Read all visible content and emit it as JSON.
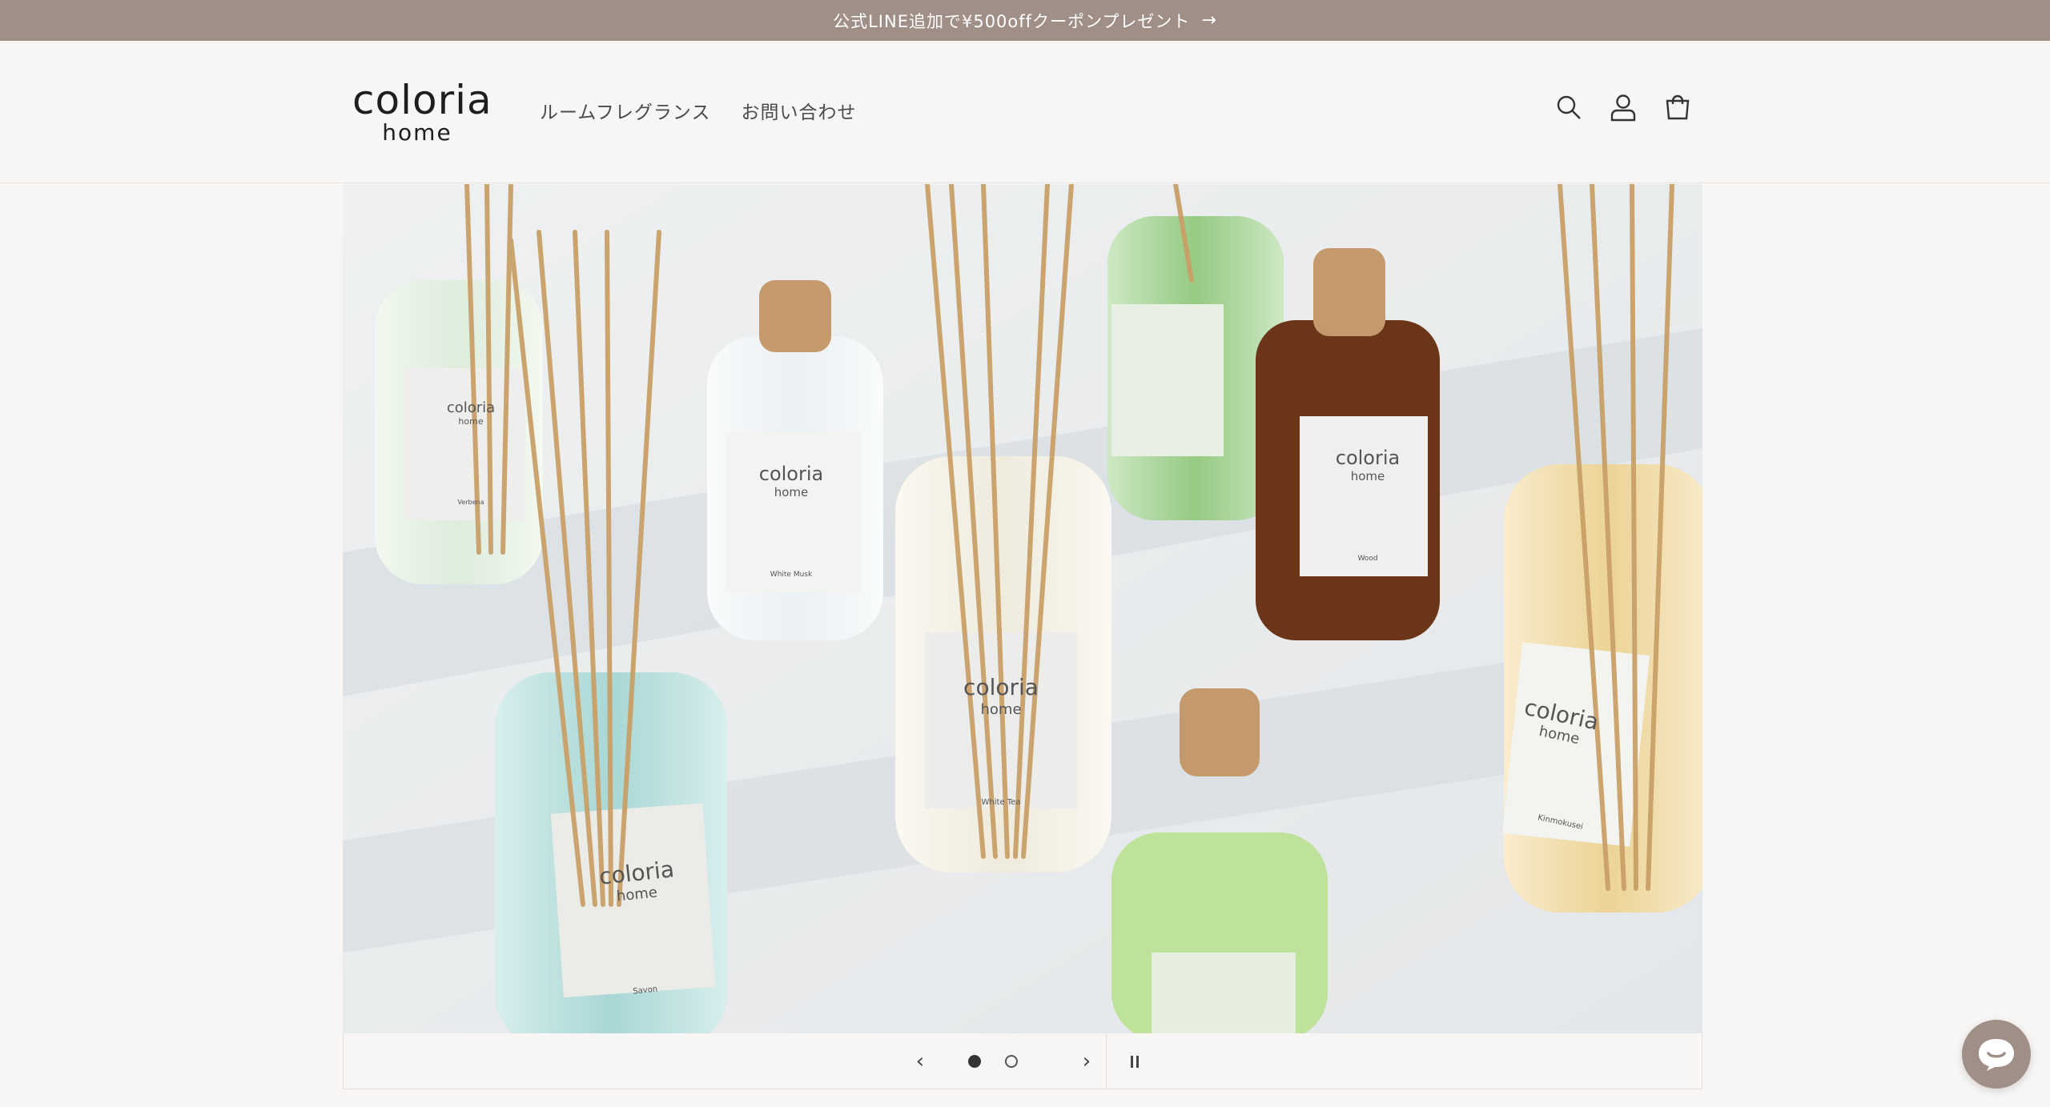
{
  "announcement": {
    "text": "公式LINE追加で¥500offクーポンプレゼント",
    "arrow": "→"
  },
  "header": {
    "logo": {
      "line1": "coloria",
      "line2": "home"
    },
    "nav": [
      {
        "label": "ルームフレグランス"
      },
      {
        "label": "お問い合わせ"
      }
    ],
    "icons": [
      "search-icon",
      "account-icon",
      "cart-icon"
    ]
  },
  "hero": {
    "bottle_label_brand": "coloria",
    "bottle_label_sub": "home",
    "bottle_names": [
      "White Tea",
      "Kinmokusei",
      "Savon",
      "White Musk",
      "Wood",
      "Verbena"
    ]
  },
  "slider": {
    "prev": "‹",
    "next": "›",
    "slide_count": 2,
    "active_slide": 1
  },
  "colors": {
    "announcement_bg": "#a08f87",
    "page_bg": "#f8f6f4",
    "text": "#3b3b3b"
  }
}
